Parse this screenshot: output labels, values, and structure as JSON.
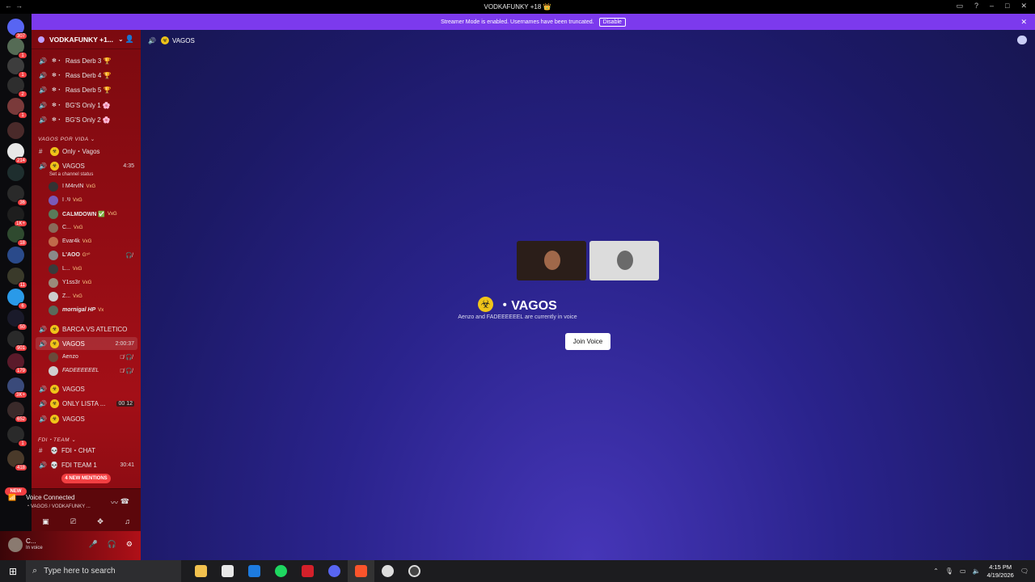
{
  "window": {
    "title": "VODKAFUNKY +18 👑"
  },
  "banner": {
    "text": "Streamer Mode is enabled. Usernames have been truncated.",
    "button": "Disable"
  },
  "rail": {
    "home_badge": "307",
    "badges": [
      "1",
      "1",
      "2",
      "1",
      "",
      "214",
      "",
      "36",
      "1K+",
      "18",
      "",
      "11",
      "6",
      "50",
      "901",
      "179",
      "3K+",
      "652",
      "1",
      "418"
    ],
    "new_label": "NEW"
  },
  "server": {
    "name": "VODKAFUNKY +1..."
  },
  "channels": {
    "top": [
      "Rass Derb 3 🏆",
      "Rass Derb 4 🏆",
      "Rass Derb 5 🏆",
      "BG'S Only 1 🌸",
      "BG'S Only 2 🌸"
    ],
    "cat1": "VAGOS POR VIDA",
    "only_vagos": "Only・Vagos",
    "vagos1": {
      "name": "VAGOS",
      "time": "4:35",
      "status": "Set a channel status"
    },
    "vagos1_users": [
      {
        "name": "I M4rvIN",
        "tag": "VxG"
      },
      {
        "name": "I .ᵗᵍ",
        "tag": "VxG"
      },
      {
        "name": "CALMDOWN ✅",
        "tag": "VxG"
      },
      {
        "name": "C...",
        "tag": "VxG"
      },
      {
        "name": "Evar4k",
        "tag": "VxG"
      },
      {
        "name": "L'AOO",
        "tag": "G⁵⁰"
      },
      {
        "name": "L...",
        "tag": "VxG"
      },
      {
        "name": "Y1ss3r",
        "tag": "VxG"
      },
      {
        "name": "Z...",
        "tag": "VxG"
      },
      {
        "name": "mornigal HP",
        "tag": "Vx"
      }
    ],
    "barca": "BARCA VS ATLETICO",
    "vagos2": {
      "name": "VAGOS",
      "time": "2:00:37"
    },
    "vagos2_users": [
      "Aenzo",
      "FADEEEEEEL"
    ],
    "vagos3": "VAGOS",
    "only_lista": {
      "name": "ONLY LISTA ...",
      "a": "00",
      "b": "12"
    },
    "vagos4": "VAGOS",
    "cat2": "FDI・TEAM",
    "fdi_chat": "FDI・CHAT",
    "fdi_team": {
      "name": "FDI TEAM 1",
      "time": "30:41"
    },
    "mentions": "4 NEW MENTIONS"
  },
  "voice_panel": {
    "title": "Voice Connected",
    "sub": "・VAGOS / VODKAFUNKY ..."
  },
  "user": {
    "name": "C...",
    "status": "In voice"
  },
  "main": {
    "header": "VAGOS",
    "title": "VAGOS",
    "subtitle": "Aenzo and FADEEEEEEL are currently in voice",
    "join": "Join Voice"
  },
  "taskbar": {
    "search": "Type here to search",
    "time": "4:15 PM",
    "date": "4/19/2026"
  },
  "colors": {
    "banner": "#7c3aed",
    "sidebar": "#8f0c13",
    "accent_yellow": "#f0c419"
  }
}
